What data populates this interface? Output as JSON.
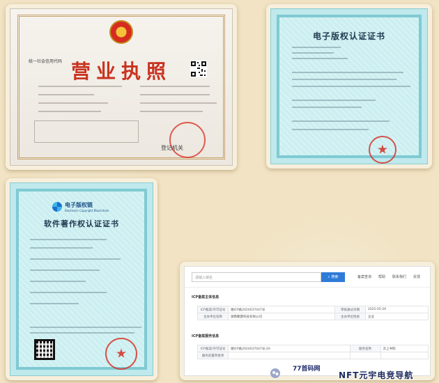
{
  "license": {
    "title": "营业执照",
    "reg_mark": "登记机关",
    "code_label": "统一社会信用代码"
  },
  "ecert": {
    "title": "电子版权认证证书"
  },
  "soft": {
    "logo_name": "电子版权链",
    "logo_sub": "Electronic Copyright Blockchain",
    "title": "软件著作权认证证书"
  },
  "icp": {
    "search_placeholder": "请输入域名",
    "search_button": "搜索",
    "links": [
      "备案查询",
      "帮助",
      "联系我们",
      "反馈"
    ],
    "section_main": "ICP备案主体信息",
    "section_site": "ICP备案服务信息",
    "main_rows": [
      [
        "ICP备案/许可证号",
        "湘ICP备2024037047号",
        "审核通过日期",
        "2025-05-26"
      ],
      [
        "主办单位名称",
        "湖南聚霆科技有限公司",
        "主办单位性质",
        "企业"
      ]
    ],
    "site_rows": [
      [
        "ICP备案/许可证号",
        "湘ICP备2024037047号-2A",
        "服务名称",
        "云上书院"
      ],
      [
        "服务前置审批项",
        "",
        "",
        ""
      ]
    ]
  },
  "watermark": {
    "site": "77首码网",
    "brand": "NFT元宇电竞导航"
  },
  "colors": {
    "license_red": "#c8331f",
    "cert_blue": "#bfe9ec",
    "icp_button": "#2f7bd8"
  }
}
